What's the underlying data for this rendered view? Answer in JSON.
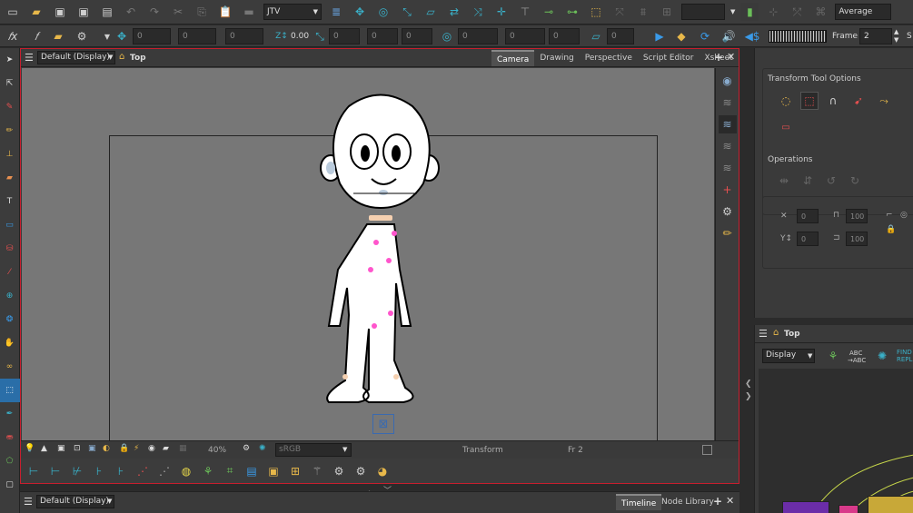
{
  "top_toolbar": {
    "renderer_value": "JTV",
    "blend_value": "Average",
    "frame_label": "Frame",
    "frame_value": "2",
    "s_label": "S",
    "zoom_offset": "0.00",
    "field_zero": "0"
  },
  "view": {
    "display_select": "Default (Display)",
    "view_title": "Top",
    "tabs": [
      "Camera",
      "Drawing",
      "Perspective",
      "Script Editor",
      "Xsheet"
    ],
    "active_tab": "Camera",
    "zoom": "40%",
    "color_space": "sRGB",
    "status_tool": "Transform",
    "status_frame": "Fr 2"
  },
  "tool_options": {
    "title": "Transform Tool Options",
    "operations_title": "Operations",
    "x_value": "0",
    "y_value": "0",
    "w_value": "100",
    "h_value": "100"
  },
  "node_view": {
    "title": "Top",
    "display_select": "Display",
    "abc_label": "ABC",
    "abc_sub": "→ABC",
    "find_label": "FIND",
    "repl_label": "REPL"
  },
  "bottom_panel": {
    "display_select": "Default (Display)",
    "tabs": [
      "Timeline",
      "Node Library"
    ]
  },
  "colors": {
    "accent_red": "#c81e2e",
    "selected_blue": "#2a6ea8",
    "node_purple": "#6b2da8"
  }
}
